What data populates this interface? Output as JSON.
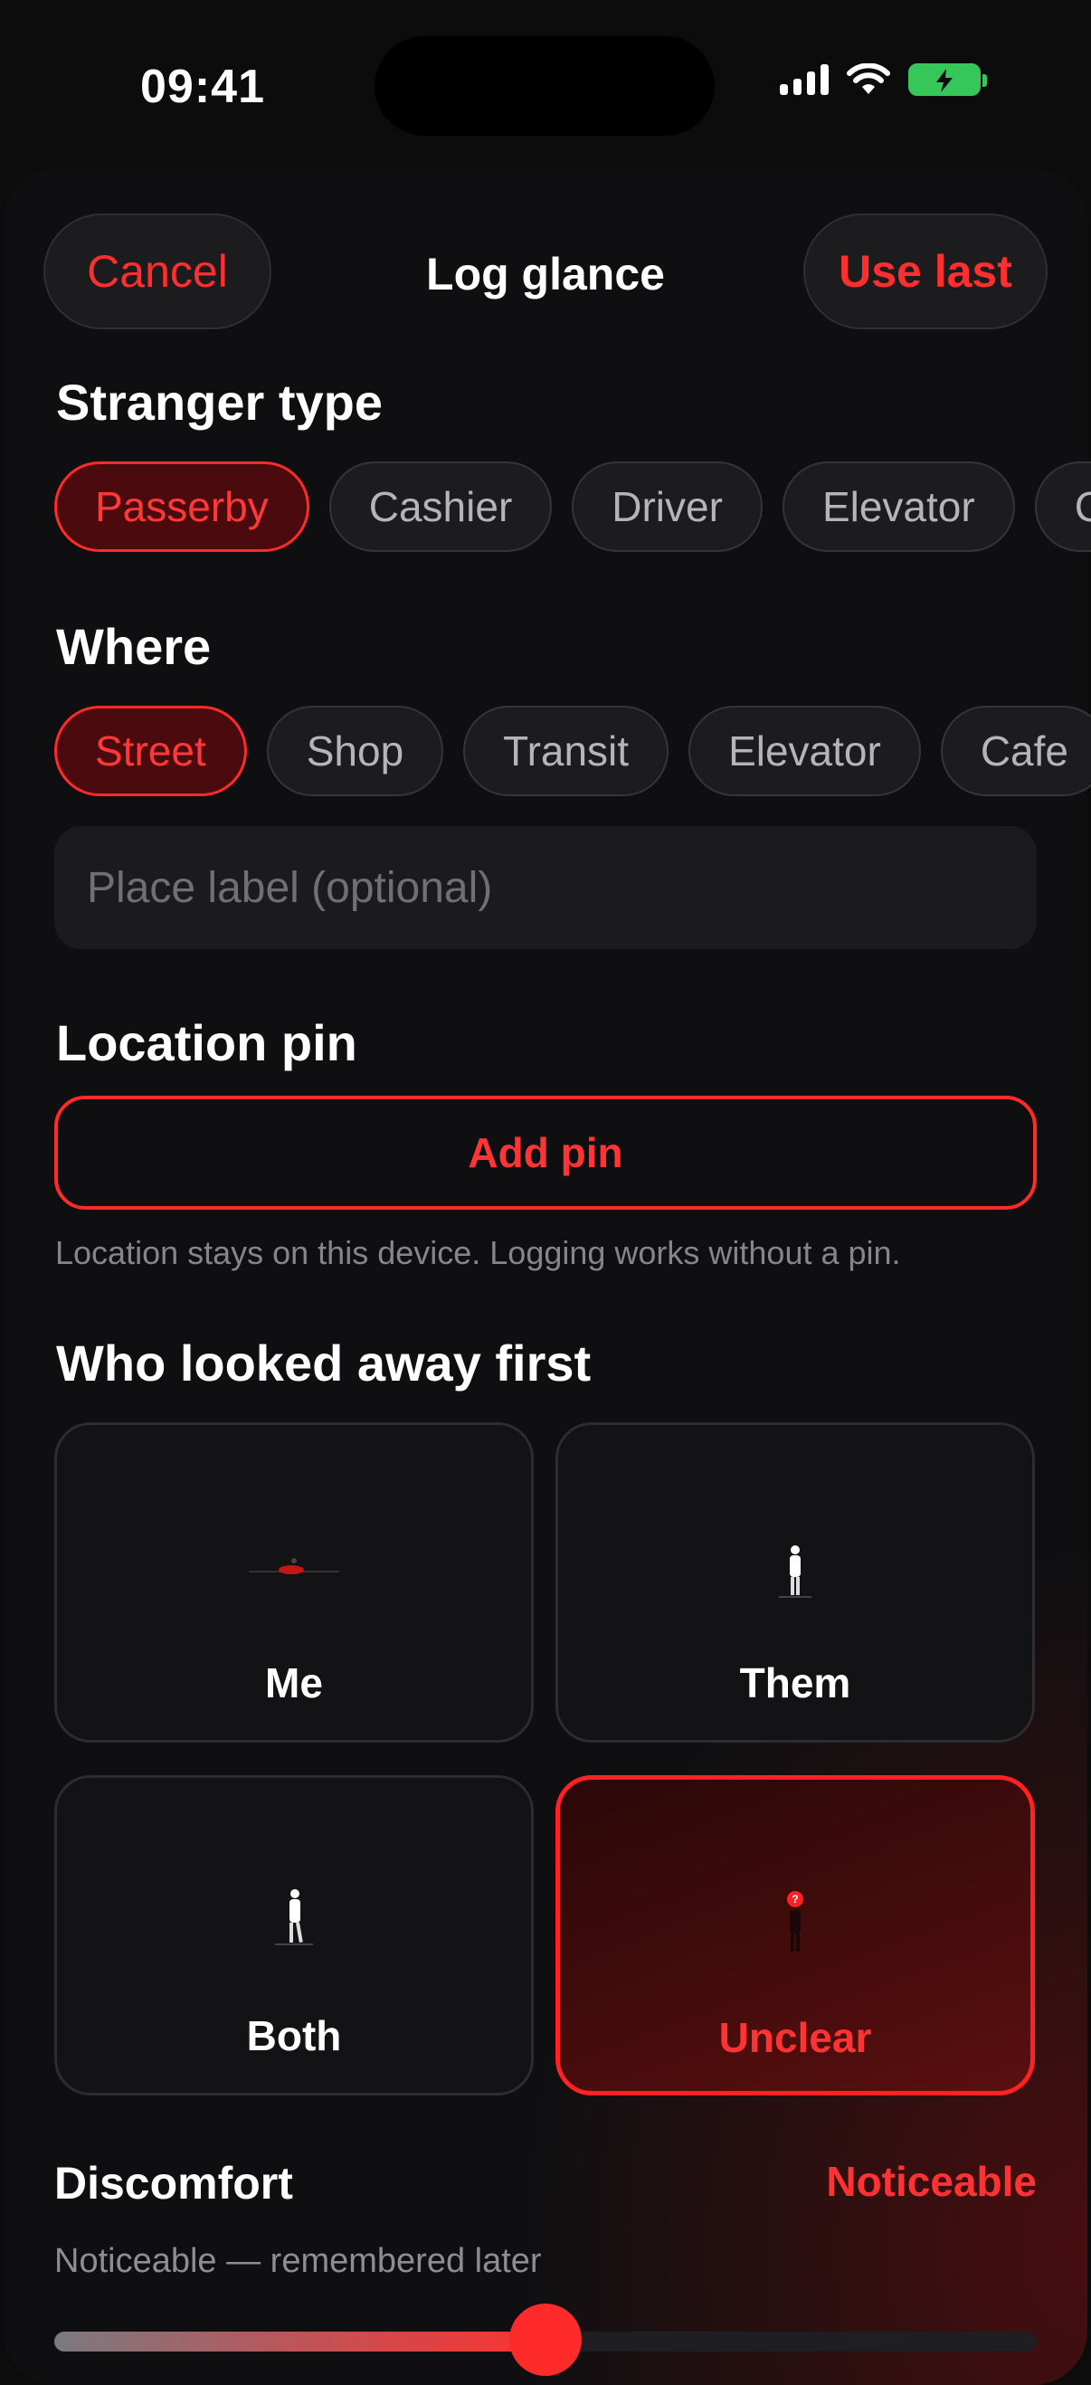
{
  "status": {
    "time": "09:41",
    "icons": [
      "signal-icon",
      "wifi-icon",
      "battery-charging-icon"
    ]
  },
  "header": {
    "cancel_label": "Cancel",
    "title": "Log glance",
    "use_last_label": "Use last"
  },
  "stranger_type": {
    "title": "Stranger type",
    "chips": [
      {
        "label": "Passerby",
        "active": true
      },
      {
        "label": "Cashier",
        "active": false
      },
      {
        "label": "Driver",
        "active": false
      },
      {
        "label": "Elevator",
        "active": false
      },
      {
        "label": "C",
        "active": false
      }
    ]
  },
  "where": {
    "title": "Where",
    "chips": [
      {
        "label": "Street",
        "active": true
      },
      {
        "label": "Shop",
        "active": false
      },
      {
        "label": "Transit",
        "active": false
      },
      {
        "label": "Elevator",
        "active": false
      },
      {
        "label": "Cafe",
        "active": false
      }
    ],
    "place_placeholder": "Place label (optional)"
  },
  "location_pin": {
    "title": "Location pin",
    "add_pin_label": "Add pin",
    "note": "Location stays on this device. Logging works without a pin."
  },
  "looked_away": {
    "title": "Who looked away first",
    "options": [
      {
        "label": "Me",
        "selected": false,
        "icon": "figure-down-icon"
      },
      {
        "label": "Them",
        "selected": false,
        "icon": "figure-standing-icon"
      },
      {
        "label": "Both",
        "selected": false,
        "icon": "figure-walking-icon"
      },
      {
        "label": "Unclear",
        "selected": true,
        "icon": "figure-question-icon"
      }
    ]
  },
  "discomfort": {
    "title": "Discomfort",
    "value_label": "Noticeable",
    "note": "Noticeable — remembered later",
    "level": 0.5
  },
  "colors": {
    "accent": "#ff2a2a",
    "background": "#0f0f11",
    "chip": "#1c1c1f"
  }
}
